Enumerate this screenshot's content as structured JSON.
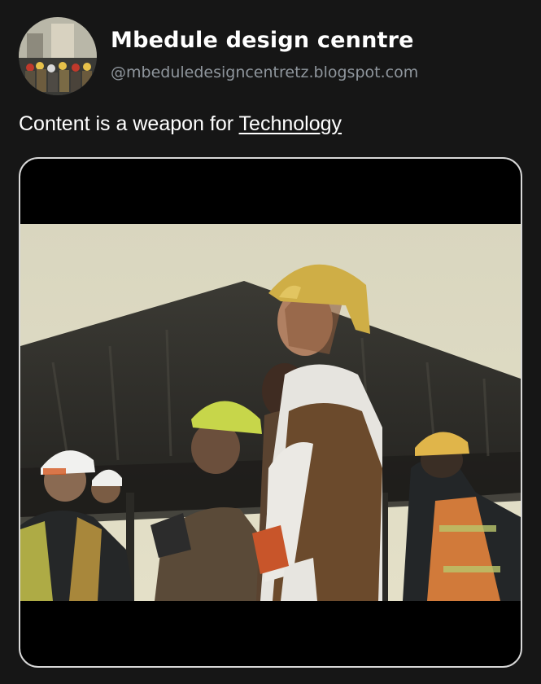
{
  "profile": {
    "display_name": "Mbedule design cenntre",
    "handle": "@mbeduledesigncentretz.blogspot.com",
    "avatar_icon": "profile-photo-construction-crowd"
  },
  "post": {
    "text_prefix": "Content is a weapon for ",
    "link_text": "Technology"
  },
  "media": {
    "type": "video-still",
    "description_icon": "construction-workers-hard-hats-image"
  },
  "colors": {
    "background": "#161616",
    "handle": "#8f969d",
    "media_border": "#d8d8d8"
  }
}
